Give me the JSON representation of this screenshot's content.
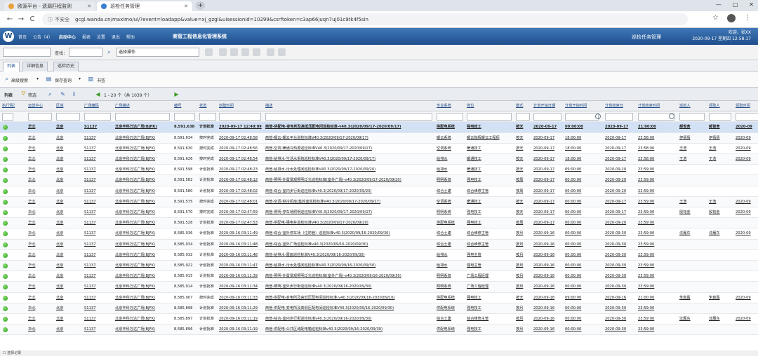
{
  "browser": {
    "tabs": [
      {
        "label": "欧源平台 - 遗漏匹程监则"
      },
      {
        "label": "巡检任务管理"
      }
    ],
    "new_tab": "+",
    "window_buttons": [
      "—",
      "□",
      "✕"
    ],
    "nav": {
      "back": "←",
      "forward": "→",
      "reload": "C"
    },
    "security": "不安全",
    "url": "gcgl.wanda.cn/maximo/ui/?event=loadapp&value=xj_gzgl&uisessionid=10299&csrftoken=c3ap66juqn7uj01c9tk4f5sin",
    "right_icons": {
      "star": "☆",
      "menu": "⋮"
    }
  },
  "app": {
    "logo": "W",
    "menu": [
      "首页",
      "公告（4）",
      "启动中心",
      "报表",
      "设置",
      "退出",
      "帮助"
    ],
    "menu_active_index": 2,
    "title": "商管工程信息化管理系统",
    "center_title": "巡检任务管理",
    "welcome": "欢迎，张XX",
    "datetime": "2020-09-17 星期四  12:58:17"
  },
  "toolbar": {
    "find_label": "查找：",
    "action_select": "选择操作",
    "search_icon": "⌕"
  },
  "subtabs": [
    "列表",
    "详细信息",
    "巡检历史"
  ],
  "subtab_active": 0,
  "query_bar": {
    "advanced_search": "高级搜索",
    "save_query": "保存查询",
    "bookmark": "书签"
  },
  "list_bar": {
    "title": "列表",
    "filter": "筛选",
    "pager": "1 - 20 个（共 1039 个）"
  },
  "table": {
    "columns": [
      "状态",
      "运营中心",
      "区域",
      "广场编码",
      "广场描述",
      "编号",
      "状态",
      "创建时间",
      "描述",
      "专业系统",
      "岗位",
      "模式",
      "计划开始日期",
      "计划开始时间",
      "计划结束日",
      "计划结束时间",
      "巡检人",
      "领取人",
      "领取时间"
    ],
    "first_col_header": "执行情况",
    "rows": [
      [
        "华北",
        "北京",
        "S1137",
        "北京丰科万达广场(BJFK)",
        "8,591,638",
        "计划批准",
        "2020-09-17 12:49:09",
        "商管-供配电-变电所及高低压配电间巡检标准-v40.3(2020/09/17-2020/09/17)",
        "供配电系统",
        "强电技工",
        "按天",
        "2020-09-17",
        "09:00:00",
        "2020-09-17",
        "21:00:00",
        "郝俊舍",
        "郝俊舍",
        "2020-09"
      ],
      [
        "华北",
        "北京",
        "S1137",
        "北京丰科万达广场(BJFK)",
        "8,591,634",
        "按时完成",
        "2020-09-17 02:48:58",
        "商管-暖云-暖云平台巡检标准V40.3(2020/09/17-2020/09/17)",
        "暖云系统",
        "暖云指挥暖云工程师",
        "按天",
        "2020-09-17",
        "18:00:00",
        "2020-09-17",
        "23:58:00",
        "伊倩倩",
        "伊倩倩",
        "2020-09"
      ],
      [
        "华北",
        "北京",
        "S1137",
        "北京丰科万达广场(BJFK)",
        "8,591,630",
        "按时完成",
        "2020-09-17 02:48:56",
        "商管-空调-暖通冷热源巡检标准V40.3(2020/09/17-2020/09/17)",
        "空调系统",
        "暖通技工",
        "按天",
        "2020-09-17",
        "18:00:00",
        "2020-09-17",
        "23:58:00",
        "王浩",
        "王浩",
        "2020-09"
      ],
      [
        "华北",
        "北京",
        "S1137",
        "北京丰科万达广场(BJFK)",
        "8,591,626",
        "按时完成",
        "2020-09-17 02:48:54",
        "商管-给排水-生活水系统巡检标准V40.3(2020/09/17-2020/09/17)",
        "给排水",
        "暖通技工",
        "按天",
        "2020-09-17",
        "18:00:00",
        "2020-09-17",
        "23:58:00",
        "王浩",
        "王浩",
        "2020-09"
      ],
      [
        "华北",
        "北京",
        "S1137",
        "北京丰科万达广场(BJFK)",
        "8,591,598",
        "计划批准",
        "2020-09-17 02:48:23",
        "商管-给排水-污水处理间巡检标准V40.3(2020/09/17-2020/09/20)",
        "给排水",
        "暖通技工",
        "按天",
        "2020-09-17",
        "09:00:00",
        "2020-09-20",
        "23:59:00",
        "",
        "",
        " "
      ],
      [
        "华北",
        "北京",
        "S1137",
        "北京丰科万达广场(BJFK)",
        "8,591,582",
        "计划批准",
        "2020-09-17 02:48:12",
        "商管-照明-外置景观照明泛光巡检标准(室外广场)-v40.3(2020/09/17-2020/09/20)",
        "照明系统",
        "强电技工",
        "按周",
        "2020-09-17",
        "00:00:00",
        "2020-09-20",
        "23:59:00",
        "",
        "",
        " "
      ],
      [
        "华北",
        "北京",
        "S1137",
        "北京丰科万达广场(BJFK)",
        "8,591,580",
        "计划批准",
        "2020-09-17 02:48:02",
        "商管-综合-室内步行街巡检标准v40.3(2020/09/17-2020/09/20)",
        "综合土建",
        "综合维修主管",
        "按周",
        "2020-09-17",
        "00:00:00",
        "2020-09-20",
        "23:59:00",
        "",
        "",
        " "
      ],
      [
        "华北",
        "北京",
        "S1137",
        "北京丰科万达广场(BJFK)",
        "8,591,575",
        "按时完成",
        "2020-09-17 02:48:01",
        "商管-空调-制冷机房/集控室巡检标准V40.3(2020/09/17-2020/09/17)",
        "空调系统",
        "暖通技工",
        "按天",
        "2020-09-17",
        "00:00:00",
        "2020-09-17",
        "23:59:00",
        "王浩",
        "王浩",
        "2020-09"
      ],
      [
        "华北",
        "北京",
        "S1137",
        "北京丰科万达广场(BJFK)",
        "8,591,570",
        "按时完成",
        "2020-09-17 02:47:59",
        "商管-照明-停车场照明巡检标准V40.3(2020/09/17-2020/09/17)",
        "照明系统",
        "强电技工",
        "按天",
        "2020-09-17",
        "00:00:00",
        "2020-09-17",
        "23:59:00",
        "殷铭金",
        "殷铭金",
        "2020-09"
      ],
      [
        "华北",
        "北京",
        "S1137",
        "北京丰科万达广场(BJFK)",
        "8,591,528",
        "计划批准",
        "2020-09-17 02:47:53",
        "商管-供配电-强电井巡检标准V40.3(2020/09/17-2020/09/20)",
        "供配电系统",
        "强电技工",
        "按周",
        "2020-09-17",
        "00:00:00",
        "2020-09-20",
        "23:59:00",
        "",
        "",
        " "
      ],
      [
        "华北",
        "北京",
        "S1137",
        "北京丰科万达广场(BJFK)",
        "8,585,936",
        "计划批准",
        "2020-09-16 03:11:49",
        "商管-综合-室外停车场（位防管）巡检标准v40.3(2020/09/16-2020/09/30)",
        "综合土建",
        "综合维修主管",
        "按月",
        "2020-09-16",
        "00:00:00",
        "2020-09-30",
        "23:59:00",
        "沈雁东",
        "沈雁东",
        "2020-09"
      ],
      [
        "华北",
        "北京",
        "S1137",
        "北京丰科万达广场(BJFK)",
        "8,585,934",
        "计划批准",
        "2020-09-16 03:11:48",
        "商管-综合-室外广场巡检标准v40.3(2020/09/16-2020/09/30)",
        "综合土建",
        "综合维修主管",
        "按月",
        "2020-09-16",
        "00:00:00",
        "2020-09-30",
        "23:59:00",
        "",
        "",
        " "
      ],
      [
        "华北",
        "北京",
        "S1137",
        "北京丰科万达广场(BJFK)",
        "8,585,932",
        "计划批准",
        "2020-09-16 03:11:48",
        "商管-给排水-屋面巡检标准V40.3(2020/09/16-2020/09/30)",
        "给排水",
        "强电主管",
        "按月",
        "2020-09-16",
        "00:00:00",
        "2020-09-30",
        "23:59:00",
        "",
        "",
        " "
      ],
      [
        "华北",
        "北京",
        "S1137",
        "北京丰科万达广场(BJFK)",
        "8,585,922",
        "计划批准",
        "2020-09-16 03:11:47",
        "商管-给排水-污水处理间巡检标准V40.3(2020/09/16-2020/09/30)",
        "给排水",
        "强电主管",
        "按月",
        "2020-09-16",
        "00:00:00",
        "2020-09-30",
        "23:59:00",
        "",
        "",
        " "
      ],
      [
        "华北",
        "北京",
        "S1137",
        "北京丰科万达广场(BJFK)",
        "8,585,915",
        "计划批准",
        "2020-09-16 03:11:39",
        "商管-照明-外置景观照明泛光巡检标准(室外广场)-v40.3(2020/09/16-2020/09/30)",
        "照明系统",
        "广场工程经理",
        "按月",
        "2020-09-16",
        "00:00:00",
        "2020-09-30",
        "23:59:00",
        "",
        "",
        " "
      ],
      [
        "华北",
        "北京",
        "S1137",
        "北京丰科万达广场(BJFK)",
        "8,585,914",
        "计划批准",
        "2020-09-16 03:11:34",
        "商管-照明-室外步行街巡检标准v40.3(2020/09/16-2020/09/30)",
        "照明系统",
        "广场工程经理",
        "按月",
        "2020-09-16",
        "00:00:00",
        "2020-09-30",
        "23:59:00",
        "",
        "",
        " "
      ],
      [
        "华北",
        "北京",
        "S1137",
        "北京丰科万达广场(BJFK)",
        "8,585,907",
        "按时完成",
        "2020-09-16 03:11:33",
        "商管-供配电-变电所及高低压配电间巡检标准-v40.3(2020/09/16-2020/09/16)",
        "供配电系统",
        "强电技工",
        "按天",
        "2020-09-16",
        "09:00:00",
        "2020-09-16",
        "21:00:00",
        "朱宸露",
        "朱宸露",
        "2020-09"
      ],
      [
        "华北",
        "北京",
        "S1137",
        "北京丰科万达广场(BJFK)",
        "8,585,898",
        "计划批准",
        "2020-09-16 03:11:29",
        "商管-供配电-变电所及高低压配电间巡检标准V40.3(2020/09/16-2020/09/30)",
        "供配电系统",
        "强电技工",
        "按月",
        "2020-09-16",
        "00:00:00",
        "2020-09-30",
        "23:59:00",
        "",
        "",
        " "
      ],
      [
        "华北",
        "北京",
        "S1137",
        "北京丰科万达广场(BJFK)",
        "8,585,897",
        "计划批准",
        "2020-09-16 03:11:19",
        "商管-综合-室内步行街巡检标准v40.3(2020/09/16-2020/09/30)",
        "综合土建",
        "综合维修主管",
        "按月",
        "2020-09-16",
        "00:00:00",
        "2020-09-30",
        "23:59:00",
        "沈雁东",
        "沈雁东",
        "2020-09"
      ],
      [
        "华北",
        "北京",
        "S1137",
        "北京丰科万达广场(BJFK)",
        "8,585,896",
        "计划批准",
        "2020-09-16 03:11:19",
        "商管-供配电-公共区域配电箱巡检标准v40.3(2020/09/16-2020/09/30)",
        "供配电系统",
        "强电技工",
        "按月",
        "2020-09-16",
        "00:00:00",
        "2020-09-30",
        "23:59:00",
        "",
        "",
        " "
      ]
    ]
  },
  "statusbar": {
    "label": "选择记录"
  },
  "colors": {
    "header_blue": "#1f4f8c",
    "status_green": "#239a10",
    "selected_row": "#d3e1f4"
  }
}
